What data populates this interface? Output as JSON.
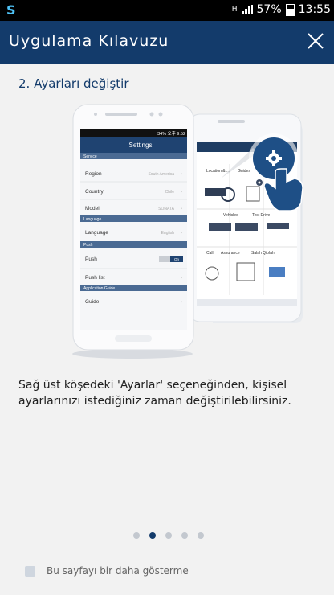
{
  "status_bar": {
    "network_label": "H",
    "battery": "57%",
    "time": "13:55"
  },
  "app_bar": {
    "title": "Uygulama Kılavuzu",
    "close_icon": "close-icon"
  },
  "guide": {
    "step_title": "2. Ayarları değiştir",
    "description": "Sağ üst köşedeki 'Ayarlar' seçeneğinden, kişisel ayarlarınızı istediğiniz zaman değiştirilebilirsiniz.",
    "page_count": 5,
    "current_page": 2
  },
  "illustration": {
    "front_phone": {
      "status": "34% 오후 9:52",
      "header": "Settings",
      "sections": [
        {
          "title": "Service",
          "rows": [
            {
              "label": "Region",
              "value": "South America"
            },
            {
              "label": "Country",
              "value": "Chile"
            },
            {
              "label": "Model",
              "value": "SONATA"
            }
          ]
        },
        {
          "title": "Language",
          "rows": [
            {
              "label": "Language",
              "value": "English"
            }
          ]
        },
        {
          "title": "Push",
          "rows": [
            {
              "label": "Push",
              "value": "On"
            },
            {
              "label": "Push list",
              "value": ""
            }
          ]
        },
        {
          "title": "Application Guide",
          "rows": [
            {
              "label": "Guide",
              "value": ""
            }
          ]
        }
      ]
    },
    "back_phone": {
      "tiles": [
        "Location & ...",
        "Guides",
        "Vehicles",
        "Test Drive",
        "Call",
        "Assurance",
        "Salah Qiblah"
      ]
    }
  },
  "footer": {
    "dont_show_label": "Bu sayfayı bir daha gösterme"
  },
  "colors": {
    "primary": "#133b6b",
    "accent_settings_button": "#1e4f86"
  }
}
